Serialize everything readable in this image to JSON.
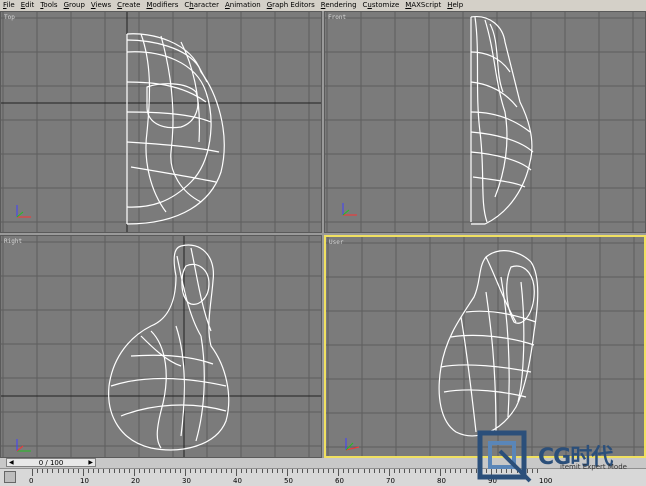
{
  "menu": [
    {
      "label": "File",
      "accel": "F"
    },
    {
      "label": "Edit",
      "accel": "E"
    },
    {
      "label": "Tools",
      "accel": "T"
    },
    {
      "label": "Group",
      "accel": "G"
    },
    {
      "label": "Views",
      "accel": "V"
    },
    {
      "label": "Create",
      "accel": "C"
    },
    {
      "label": "Modifiers",
      "accel": "M"
    },
    {
      "label": "Character",
      "accel": "h"
    },
    {
      "label": "Animation",
      "accel": "A"
    },
    {
      "label": "Graph Editors",
      "accel": "G"
    },
    {
      "label": "Rendering",
      "accel": "R"
    },
    {
      "label": "Customize",
      "accel": "u"
    },
    {
      "label": "MAXScript",
      "accel": "M"
    },
    {
      "label": "Help",
      "accel": "H"
    }
  ],
  "viewports": {
    "top": {
      "label": "Top"
    },
    "front": {
      "label": "Front"
    },
    "right": {
      "label": "Right"
    },
    "user": {
      "label": "User"
    }
  },
  "timeline": {
    "slider_text": "0 / 100",
    "ticks": [
      "0",
      "10",
      "20",
      "30",
      "40",
      "50",
      "60",
      "70",
      "80",
      "90",
      "100"
    ]
  },
  "watermark": {
    "brand": "CG时代",
    "tagline": "itemit Expert Mode"
  },
  "colors": {
    "viewport_bg": "#7b7b7b",
    "grid": "#5c5c5c",
    "wire": "#ffffff",
    "active_border": "#f0e060"
  }
}
